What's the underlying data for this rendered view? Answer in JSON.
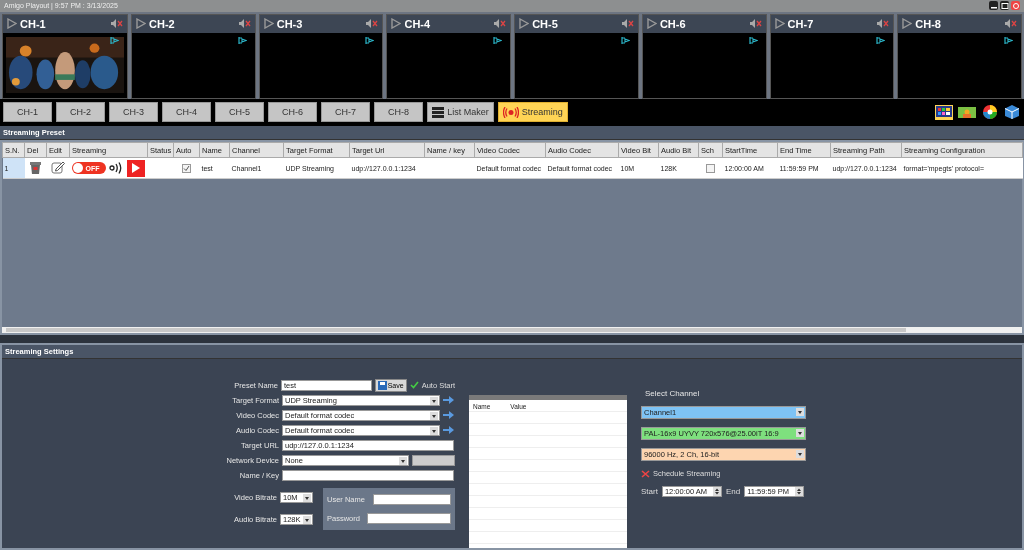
{
  "window": {
    "title": "Amigo Playout | 9:57 PM : 3/13/2025"
  },
  "channels": [
    {
      "label": "CH-1",
      "kind": "picture"
    },
    {
      "label": "CH-2",
      "kind": "blank"
    },
    {
      "label": "CH-3",
      "kind": "blank"
    },
    {
      "label": "CH-4",
      "kind": "blank"
    },
    {
      "label": "CH-5",
      "kind": "blank"
    },
    {
      "label": "CH-6",
      "kind": "blank"
    },
    {
      "label": "CH-7",
      "kind": "blank"
    },
    {
      "label": "CH-8",
      "kind": "blank"
    }
  ],
  "tabs": [
    {
      "label": "CH-1",
      "kind": "plain",
      "selected": false
    },
    {
      "label": "CH-2",
      "kind": "plain",
      "selected": false
    },
    {
      "label": "CH-3",
      "kind": "plain",
      "selected": false
    },
    {
      "label": "CH-4",
      "kind": "plain",
      "selected": false
    },
    {
      "label": "CH-5",
      "kind": "plain",
      "selected": false
    },
    {
      "label": "CH-6",
      "kind": "plain",
      "selected": false
    },
    {
      "label": "CH-7",
      "kind": "plain",
      "selected": false
    },
    {
      "label": "CH-8",
      "kind": "plain",
      "selected": false
    },
    {
      "label": "List Maker",
      "kind": "list",
      "selected": false
    },
    {
      "label": "Streaming",
      "kind": "stream",
      "selected": true
    }
  ],
  "preset": {
    "title": "Streaming Preset",
    "columns": [
      "S.N.",
      "Del",
      "Edit",
      "Streaming",
      "Status",
      "Auto",
      "Name",
      "Channel",
      "Target Format",
      "Target Url",
      "Name / key",
      "Video Codec",
      "Audio Codec",
      "Video Bit",
      "Audio Bit",
      "Sch",
      "StartTime",
      "End Time",
      "Streaming Path",
      "Streaming Configuration"
    ],
    "rows": [
      {
        "sn": "1",
        "toggle": {
          "label": "OFF",
          "on": false
        },
        "auto": true,
        "name": "test",
        "channel": "Channel1",
        "target_format": "UDP Streaming",
        "target_url": "udp://127.0.0.1:1234",
        "video_codec": "Default format codec",
        "audio_codec": "Default format codec",
        "video_bit": "10M",
        "audio_bit": "128K",
        "sch": false,
        "start_time": "12:00:00 AM",
        "end_time": "11:59:59 PM",
        "streaming_path": "udp://127.0.0.1:1234",
        "config": "format='mpegts' protocol="
      }
    ]
  },
  "settings": {
    "title": "Streaming Settings",
    "preset_name": {
      "label": "Preset Name",
      "value": "test"
    },
    "save": "Save",
    "auto_start": {
      "label": "Auto Start",
      "checked": true
    },
    "target_format": {
      "label": "Target Format",
      "value": "UDP Streaming"
    },
    "video_codec": {
      "label": "Video Codec",
      "value": "Default format codec"
    },
    "audio_codec": {
      "label": "Audio Codec",
      "value": "Default format codec"
    },
    "target_url": {
      "label": "Target URL",
      "value": "udp://127.0.0.1:1234"
    },
    "network_device": {
      "label": "Network Device",
      "value": "None"
    },
    "name_key": {
      "label": "Name / Key"
    },
    "video_bitrate": {
      "label": "Video Bitrate",
      "value": "10M"
    },
    "audio_bitrate": {
      "label": "Audio Bitrate",
      "value": "128K"
    },
    "user_name": {
      "label": "User Name"
    },
    "password": {
      "label": "Password"
    },
    "params_columns": [
      "Name",
      "Value"
    ],
    "select_channel": {
      "label": "Select Channel",
      "channel": "Channel1",
      "video_format": "PAL-16x9 UYVY 720x576@25.00iT 16:9",
      "audio_format": "96000 Hz, 2 Ch, 16-bit"
    },
    "schedule": {
      "label": "Schedule Streaming",
      "checked": false
    },
    "start": {
      "label": "Start",
      "value": "12:00:00 AM"
    },
    "end": {
      "label": "End",
      "value": "11:59:59 PM"
    }
  }
}
